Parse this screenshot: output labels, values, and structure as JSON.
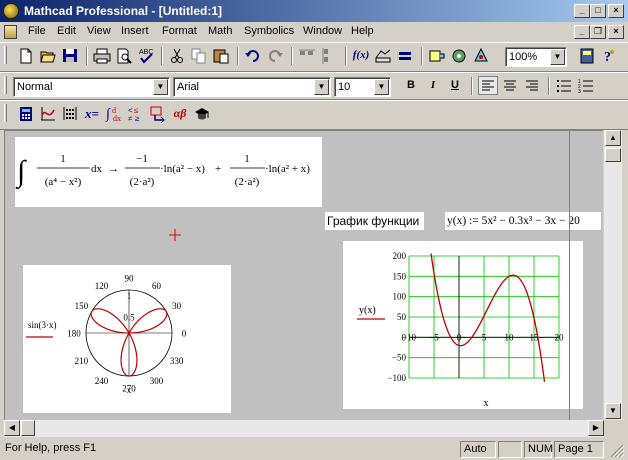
{
  "window": {
    "title": "Mathcad Professional - [Untitled:1]",
    "min_glyph": "_",
    "max_glyph": "□",
    "close_glyph": "×",
    "restore_glyph": "❐"
  },
  "menu": [
    "File",
    "Edit",
    "View",
    "Insert",
    "Format",
    "Math",
    "Symbolics",
    "Window",
    "Help"
  ],
  "standard_toolbar": {
    "zoom": "100%",
    "icons": [
      "new-document-icon",
      "open-folder-icon",
      "save-disk-icon",
      "print-icon",
      "print-preview-icon",
      "spell-check-icon",
      "cut-icon",
      "copy-icon",
      "paste-icon",
      "undo-icon",
      "redo-icon",
      "align-across-icon",
      "align-down-icon",
      "insert-function-icon",
      "insert-unit-icon",
      "calculate-icon",
      "component-icon",
      "insert-component-icon",
      "resource-center-icon",
      "help-icon"
    ]
  },
  "formatting_toolbar": {
    "style": "Normal",
    "font": "Arial",
    "size": "10",
    "bold": "B",
    "italic": "I",
    "underline": "U"
  },
  "math_toolbar": {
    "icons": [
      "calculator-palette-icon",
      "graph-palette-icon",
      "matrix-palette-icon",
      "evaluation-palette-icon",
      "calculus-palette-icon",
      "boolean-palette-icon",
      "programming-palette-icon",
      "greek-palette-icon",
      "symbolic-palette-icon"
    ],
    "labels": {
      "evaluation": "x=",
      "greek": "αβ"
    }
  },
  "worksheet": {
    "integral": {
      "one": "1",
      "minus_one": "−1",
      "plus": "+",
      "dx": "dx",
      "arrow": "→",
      "x4_den": "(a⁴ − x²)",
      "den_2a2": "(2·a²)",
      "ln_term": "·ln(a² − x)",
      "ln_term2": "·ln(a² + x)"
    },
    "text_label": "График функции",
    "definition": "y(x) := 5x² − 0.3x³ − 3x − 20",
    "polar_plot": {
      "trace_label": "sin(3·x)",
      "axis_label": "x",
      "angle_labels": [
        "0",
        "30",
        "60",
        "90",
        "120",
        "150",
        "180",
        "210",
        "240",
        "270",
        "300",
        "330"
      ],
      "radial_labels": [
        "1",
        "0.5",
        "0"
      ],
      "trace_color": "#c00000"
    },
    "xy_plot": {
      "trace_label": "y(x)",
      "x_axis_label": "x",
      "x_ticks": [
        "−10",
        "−5",
        "0",
        "5",
        "10",
        "15",
        "20"
      ],
      "y_ticks": [
        "200",
        "150",
        "100",
        "50",
        "0",
        "−50",
        "−100"
      ],
      "grid_color": "#00c000",
      "trace_color": "#c00000"
    },
    "crosshair_color": "#e00000"
  },
  "chart_data": [
    {
      "type": "scatter",
      "name": "polar",
      "formula": "r = sin(3·x)",
      "rlim": [
        0,
        1
      ],
      "radial_ticks": [
        0,
        0.5,
        1
      ],
      "angle_ticks_deg": [
        0,
        30,
        60,
        90,
        120,
        150,
        180,
        210,
        240,
        270,
        300,
        330
      ],
      "ylabel": "sin(3·x)",
      "xlabel": "x"
    },
    {
      "type": "line",
      "name": "xy",
      "formula": "y(x) = 5x² − 0.3x³ − 3x − 20",
      "xlim": [
        -10,
        20
      ],
      "ylim": [
        -100,
        200
      ],
      "x_ticks": [
        -10,
        -5,
        0,
        5,
        10,
        15,
        20
      ],
      "y_ticks": [
        -100,
        -50,
        0,
        50,
        100,
        150,
        200
      ],
      "grid": true,
      "xlabel": "x",
      "ylabel": "y(x)"
    }
  ],
  "status": {
    "help": "For Help, press F1",
    "mode": "Auto",
    "num": "NUM",
    "page": "Page 1"
  }
}
